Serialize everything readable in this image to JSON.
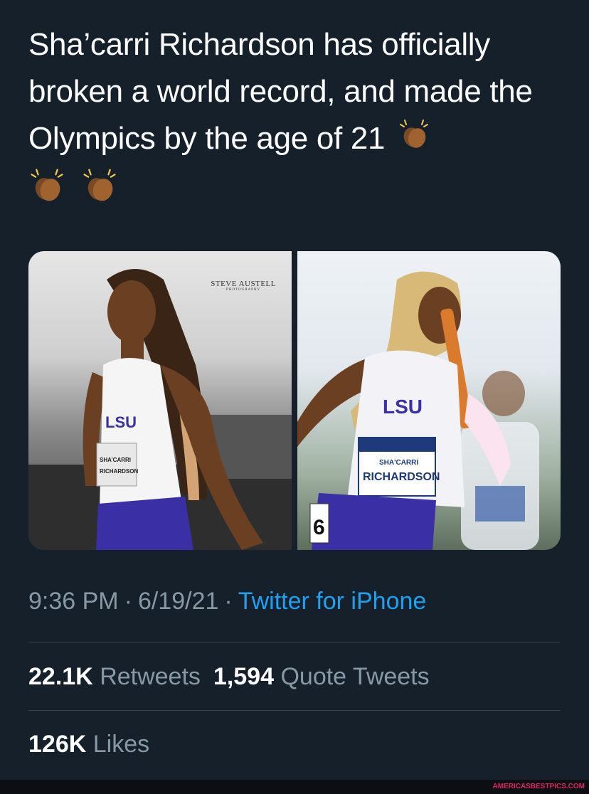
{
  "tweet": {
    "text": "Sha’carri Richardson has officially broken a world record, and made the Olympics by the age of 21",
    "emoji_icons": [
      "clapping-hands-icon",
      "clapping-hands-icon",
      "clapping-hands-icon"
    ]
  },
  "media": {
    "photos": [
      {
        "watermark_name": "STEVE AUSTELL",
        "watermark_sub": "PHOTOGRAPHY",
        "jersey_text": "LSU",
        "bib_line1": "SHA’CARRI",
        "bib_line2": "RICHARDSON"
      },
      {
        "jersey_text": "LSU",
        "bib_line1": "SHA'CARRI",
        "bib_line2": "RICHARDSON",
        "lane_number": "6"
      }
    ]
  },
  "meta": {
    "time": "9:36 PM",
    "date": "6/19/21",
    "separator": "·",
    "source": "Twitter for iPhone"
  },
  "stats": {
    "retweets_count": "22.1K",
    "retweets_label": "Retweets",
    "quotes_count": "1,594",
    "quotes_label": "Quote Tweets",
    "likes_count": "126K",
    "likes_label": "Likes"
  },
  "footer": {
    "site": "AMERICASBESTPICS.COM"
  },
  "colors": {
    "background": "#15202b",
    "link": "#1da1f2",
    "muted_text": "#8899a6",
    "divider": "#38444d"
  }
}
